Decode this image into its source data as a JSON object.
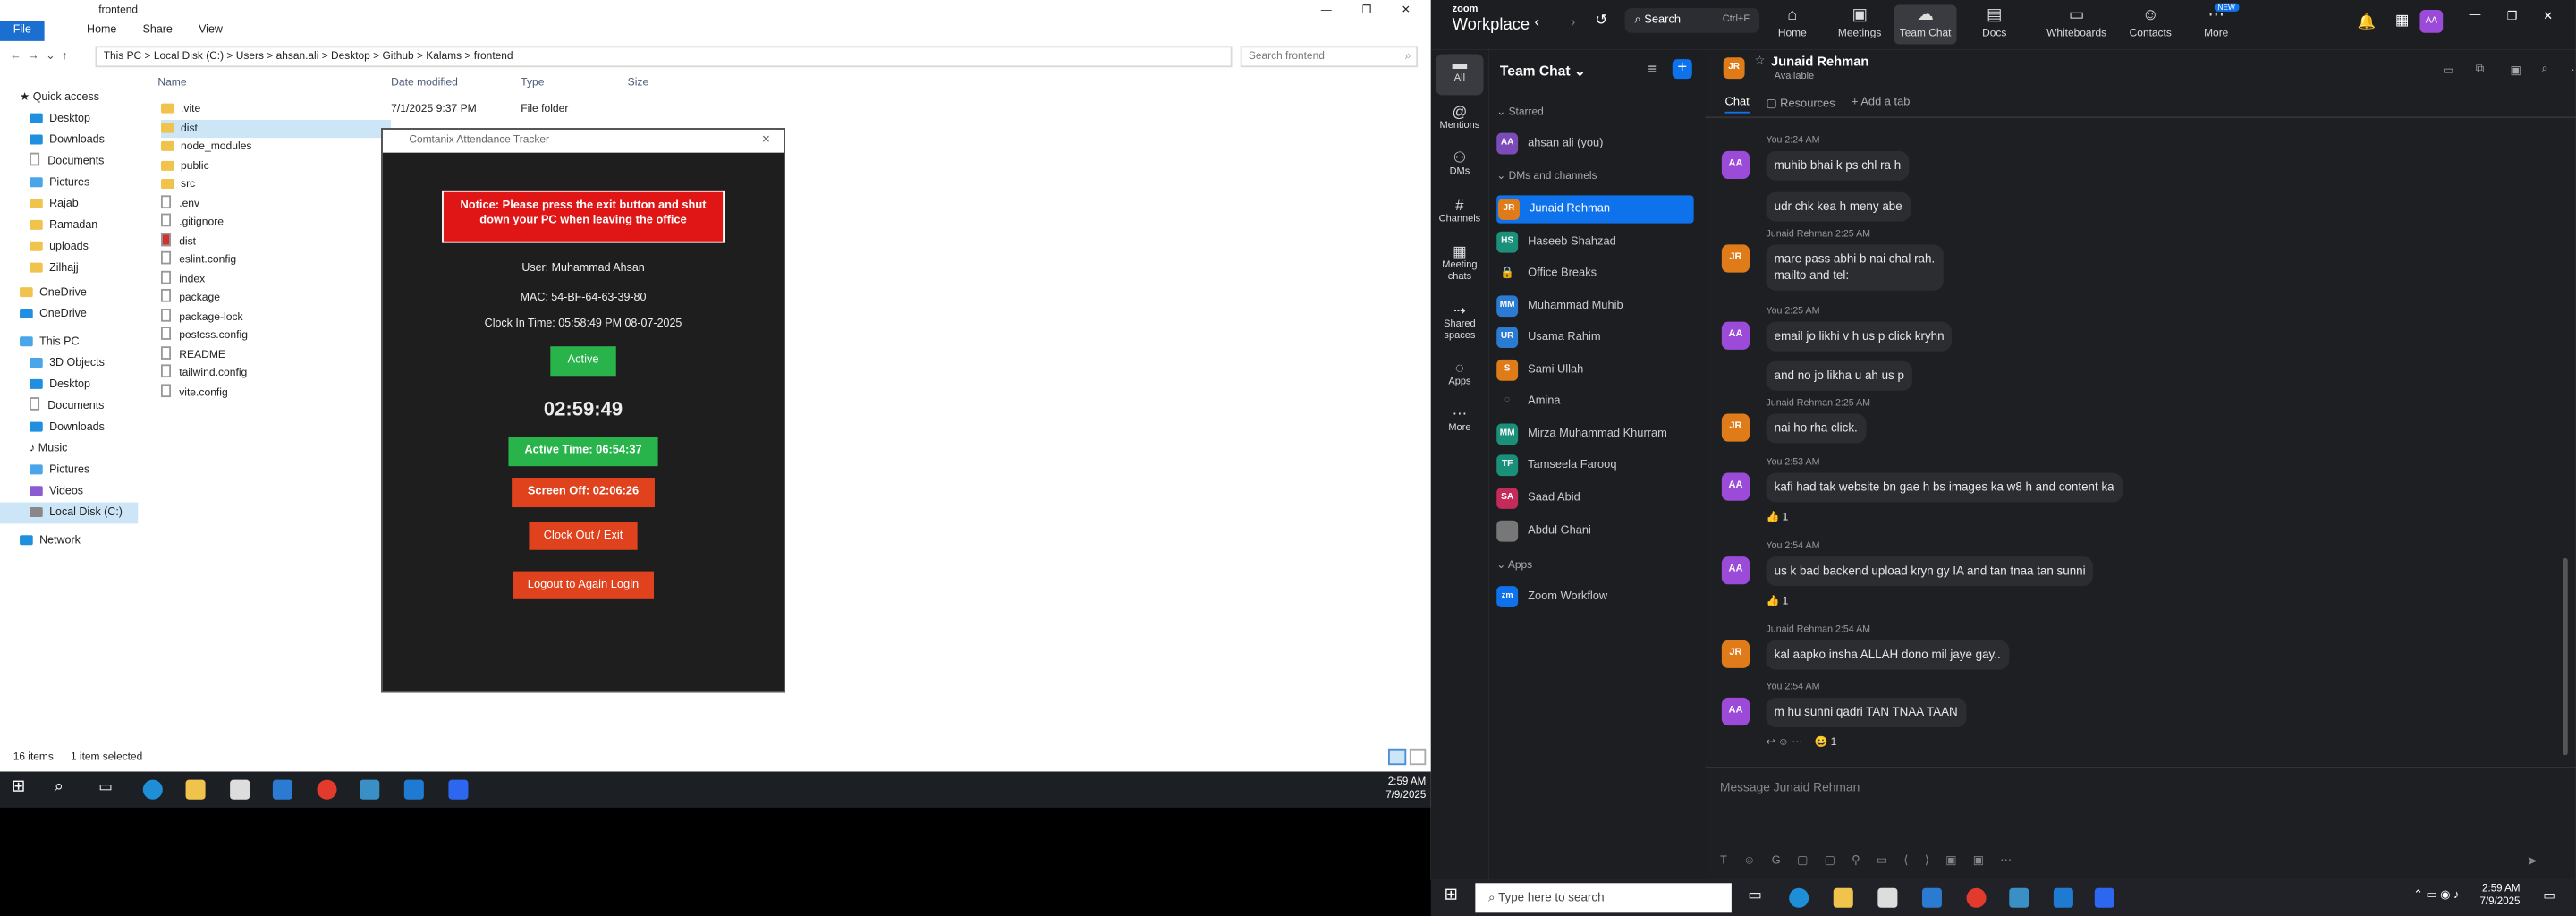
{
  "explorer": {
    "title": "frontend",
    "ribbon_tabs": [
      "File",
      "Home",
      "Share",
      "View"
    ],
    "breadcrumb": [
      "This PC",
      "Local Disk (C:)",
      "Users",
      "ahsan.ali",
      "Desktop",
      "Github",
      "Kalams",
      "frontend"
    ],
    "search_placeholder": "Search frontend",
    "nav": [
      "Quick access",
      "Desktop",
      "Downloads",
      "Documents",
      "Pictures",
      "Rajab",
      "Ramadan",
      "uploads",
      "Zilhajj",
      "OneDrive",
      "OneDrive",
      "This PC",
      "3D Objects",
      "Desktop",
      "Documents",
      "Downloads",
      "Music",
      "Pictures",
      "Videos",
      "Local Disk (C:)",
      "Network"
    ],
    "columns": [
      "Name",
      "Date modified",
      "Type",
      "Size"
    ],
    "files": [
      ".vite",
      "dist",
      "node_modules",
      "public",
      "src",
      ".env",
      ".gitignore",
      "dist",
      "eslint.config",
      "index",
      "package",
      "package-lock",
      "postcss.config",
      "README",
      "tailwind.config",
      "vite.config"
    ],
    "first_row_date": "7/1/2025 9:37 PM",
    "first_row_type": "File folder",
    "status_items": "16 items",
    "status_selected": "1 item selected"
  },
  "tracker": {
    "title": "Comtanix Attendance Tracker",
    "notice": "Notice: Please press the exit button and shut down your PC when leaving the office",
    "user": "User: Muhammad Ahsan",
    "mac": "MAC: 54-BF-64-63-39-80",
    "clock_in": "Clock In Time: 05:58:49 PM 08-07-2025",
    "status": "Active",
    "timer": "02:59:49",
    "active_time": "Active Time: 06:54:37",
    "screen_off": "Screen Off: 02:06:26",
    "clock_out": "Clock Out / Exit",
    "logout": "Logout to Again Login"
  },
  "taskbar_left": {
    "time": "2:59 AM",
    "date": "7/9/2025"
  },
  "zoom": {
    "brand_top": "zoom",
    "brand": "Workplace",
    "search": "Search",
    "search_shortcut": "Ctrl+F",
    "nav": [
      "Home",
      "Meetings",
      "Team Chat",
      "Docs",
      "Whiteboards",
      "Contacts",
      "More"
    ],
    "new_badge": "NEW",
    "user_initials": "AA",
    "rail": [
      "All",
      "Mentions",
      "DMs",
      "Channels",
      "Meeting chats",
      "Shared spaces",
      "Apps",
      "More"
    ],
    "panel_title": "Team Chat",
    "starred_label": "Starred",
    "dm_label": "DMs and channels",
    "apps_label": "Apps",
    "starred": [
      {
        "name": "ahsan ali (you)",
        "initials": "AA",
        "color": "#7b4bb8"
      }
    ],
    "contacts": [
      {
        "name": "Junaid Rehman",
        "initials": "JR",
        "color": "#e07b1a"
      },
      {
        "name": "Haseeb Shahzad",
        "initials": "HS",
        "color": "#1a8f7a"
      },
      {
        "name": "Office Breaks",
        "initials": "",
        "color": "#444"
      },
      {
        "name": "Muhammad Muhib",
        "initials": "MM",
        "color": "#2a7bd1"
      },
      {
        "name": "Usama Rahim",
        "initials": "UR",
        "color": "#2a7bd1"
      },
      {
        "name": "Sami Ullah",
        "initials": "S",
        "color": "#e07b1a"
      },
      {
        "name": "Amina",
        "initials": "",
        "color": "#555"
      },
      {
        "name": "Mirza Muhammad Khurram",
        "initials": "MM",
        "color": "#1a8f7a"
      },
      {
        "name": "Tamseela Farooq",
        "initials": "TF",
        "color": "#1a8f7a"
      },
      {
        "name": "Saad Abid",
        "initials": "SA",
        "color": "#c42a5a"
      },
      {
        "name": "Abdul Ghani",
        "initials": "",
        "color": "#666"
      }
    ],
    "app": "Zoom Workflow",
    "chat_header_initials": "JR",
    "chat_name": "Junaid Rehman",
    "chat_status": "Available",
    "chat_tabs": [
      "Chat",
      "Resources",
      "Add a tab"
    ],
    "messages": [
      {
        "meta": "You 2:24 AM",
        "initials": "AA",
        "text": "muhib bhai k ps chl ra h"
      },
      {
        "meta": "",
        "initials": "",
        "text": "udr chk kea h meny abe"
      },
      {
        "meta": "Junaid Rehman 2:25 AM",
        "initials": "JR",
        "text": "mare pass abhi b nai chal rah.",
        "text2": "mailto and tel:"
      },
      {
        "meta": "You 2:25 AM",
        "initials": "AA",
        "text": "email jo likhi v h us p click  kryhn"
      },
      {
        "meta": "",
        "initials": "",
        "text": "and no jo likha u ah  us p"
      },
      {
        "meta": "Junaid Rehman 2:25 AM",
        "initials": "JR",
        "text": "nai ho rha click."
      },
      {
        "meta": "You 2:53 AM",
        "initials": "AA",
        "text": "kafi had tak website bn gae h bs images ka w8 h and content ka",
        "reaction": "👍 1"
      },
      {
        "meta": "You 2:54 AM",
        "initials": "AA",
        "text": "us k bad backend upload kryn gy IA and tan tnaa tan sunni",
        "reaction": "👍 1"
      },
      {
        "meta": "Junaid Rehman 2:54 AM",
        "initials": "JR",
        "text": "kal aapko insha ALLAH dono mil jaye gay.."
      },
      {
        "meta": "You 2:54 AM",
        "initials": "AA",
        "text": "m hu sunni qadri  TAN TNAA TAAN",
        "reaction": "😀 1"
      }
    ],
    "composer_placeholder": "Message Junaid Rehman"
  },
  "taskbar_right": {
    "search_placeholder": "Type here to search",
    "time": "2:59 AM",
    "date": "7/9/2025"
  }
}
